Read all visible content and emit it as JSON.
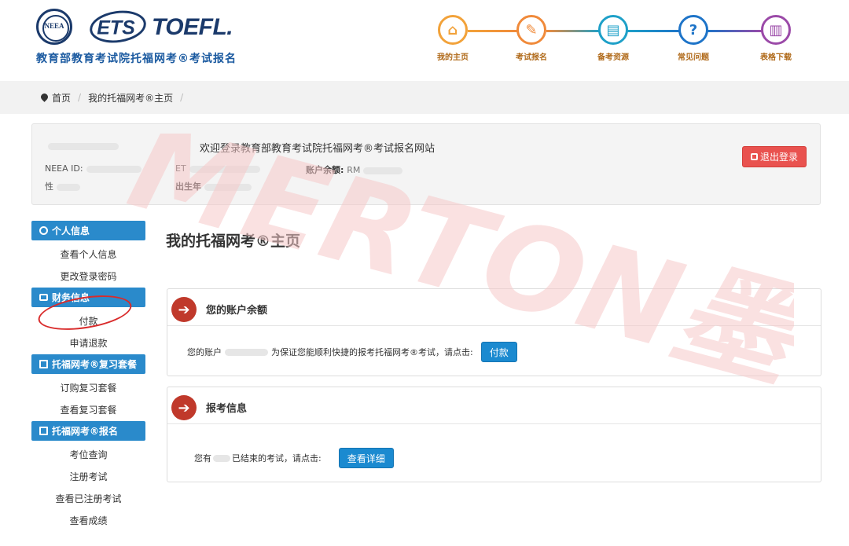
{
  "header": {
    "seal_text": "NEEA",
    "ets_logo": "ETS",
    "toefl_logo": "TOEFL.",
    "subtitle": "教育部教育考试院托福网考®考试报名",
    "nav": [
      {
        "label": "我的主页",
        "icon": "home-icon",
        "glyph": "⌂",
        "color": "#f2a23a"
      },
      {
        "label": "考试报名",
        "icon": "edit-icon",
        "glyph": "✎",
        "color": "#f08a3a"
      },
      {
        "label": "备考资源",
        "icon": "calendar-icon",
        "glyph": "▤",
        "color": "#1ea0c8"
      },
      {
        "label": "常见问题",
        "icon": "question-icon",
        "glyph": "?",
        "color": "#1e74c8"
      },
      {
        "label": "表格下载",
        "icon": "document-icon",
        "glyph": "▥",
        "color": "#9b4aa8"
      }
    ]
  },
  "breadcrumb": {
    "home": "首页",
    "current": "我的托福网考®主页",
    "separator": "/"
  },
  "welcome": {
    "title": "欢迎登录教育部教育考试院托福网考®考试报名网站",
    "neea_id_label": "NEEA ID:",
    "ets_label": "ET",
    "balance_label": "账户余额:",
    "balance_prefix": "RM",
    "gender_label": "性",
    "birth_label": "出生年",
    "logout": "退出登录"
  },
  "sidebar": {
    "sections": [
      {
        "title": "个人信息",
        "icon": "user-icon",
        "items": [
          "查看个人信息",
          "更改登录密码"
        ]
      },
      {
        "title": "财务信息",
        "icon": "card-icon",
        "items": [
          "付款",
          "申请退款"
        ]
      },
      {
        "title": "托福网考®复习套餐",
        "icon": "book-icon",
        "items": [
          "订购复习套餐",
          "查看复习套餐"
        ]
      },
      {
        "title": "托福网考®报名",
        "icon": "book-icon",
        "items": [
          "考位查询",
          "注册考试",
          "查看已注册考试",
          "查看成绩"
        ]
      }
    ]
  },
  "main": {
    "page_title": "我的托福网考®主页",
    "balance_panel": {
      "title": "您的账户余额",
      "text_start": "您的账户",
      "text_end": "为保证您能顺利快捷的报考托福网考®考试，请点击:",
      "button": "付款"
    },
    "exam_panel": {
      "title": "报考信息",
      "text_start": "您有",
      "text_end": "已结束的考试，请点击:",
      "button": "查看详细"
    }
  },
  "watermark": {
    "text": "MERTON墨顿",
    "color": "#f5c9c9"
  }
}
